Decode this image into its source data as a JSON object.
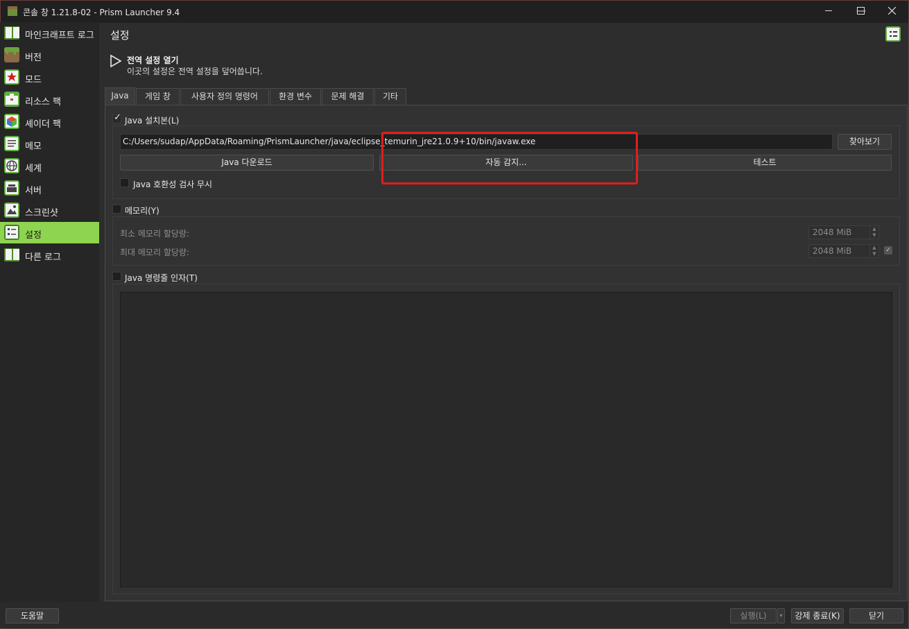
{
  "window": {
    "title": "콘솔 창 1.21.8-02 - Prism Launcher 9.4",
    "minimize": "—",
    "maximize": "☐",
    "close": "✕"
  },
  "sidebar": {
    "items": [
      {
        "label": "마인크래프트 로그",
        "icon": "book-icon"
      },
      {
        "label": "버전",
        "icon": "grass-block-icon"
      },
      {
        "label": "모드",
        "icon": "star-icon"
      },
      {
        "label": "리소스 팩",
        "icon": "briefcase-icon"
      },
      {
        "label": "셰이더 팩",
        "icon": "cube-icon"
      },
      {
        "label": "메모",
        "icon": "note-icon"
      },
      {
        "label": "세계",
        "icon": "world-icon"
      },
      {
        "label": "서버",
        "icon": "server-icon"
      },
      {
        "label": "스크린샷",
        "icon": "screenshot-icon"
      },
      {
        "label": "설정",
        "icon": "settings-icon",
        "active": true
      },
      {
        "label": "다른 로그",
        "icon": "book-icon"
      }
    ]
  },
  "header": {
    "title": "설정"
  },
  "banner": {
    "title": "전역 설정 열기",
    "subtitle": "이곳의 설정은 전역 설정을 덮어씁니다."
  },
  "tabs": [
    {
      "label": "Java",
      "active": true
    },
    {
      "label": "게임 창"
    },
    {
      "label": "사용자 정의 명령어"
    },
    {
      "label": "환경 변수"
    },
    {
      "label": "문제 해결"
    },
    {
      "label": "기타"
    }
  ],
  "java_install": {
    "group_label": "Java 설치본(L)",
    "checked": true,
    "path": "C:/Users/sudap/AppData/Roaming/PrismLauncher/java/eclipse_temurin_jre21.0.9+10/bin/javaw.exe",
    "browse_label": "찾아보기",
    "download_label": "Java 다운로드",
    "autodetect_label": "자동 감지...",
    "test_label": "테스트",
    "skip_compat_label": "Java 호환성 검사 무시"
  },
  "memory": {
    "group_label": "메모리(Y)",
    "checked": false,
    "min_label": "최소 메모리 할당량:",
    "min_value": "2048 MiB",
    "max_label": "최대 메모리 할당량:",
    "max_value": "2048 MiB"
  },
  "jvm_args": {
    "group_label": "Java 명령줄 인자(T)",
    "checked": false
  },
  "footer": {
    "help_label": "도움말",
    "launch_label": "실행(L)",
    "kill_label": "강제 종료(K)",
    "close_label": "닫기"
  }
}
